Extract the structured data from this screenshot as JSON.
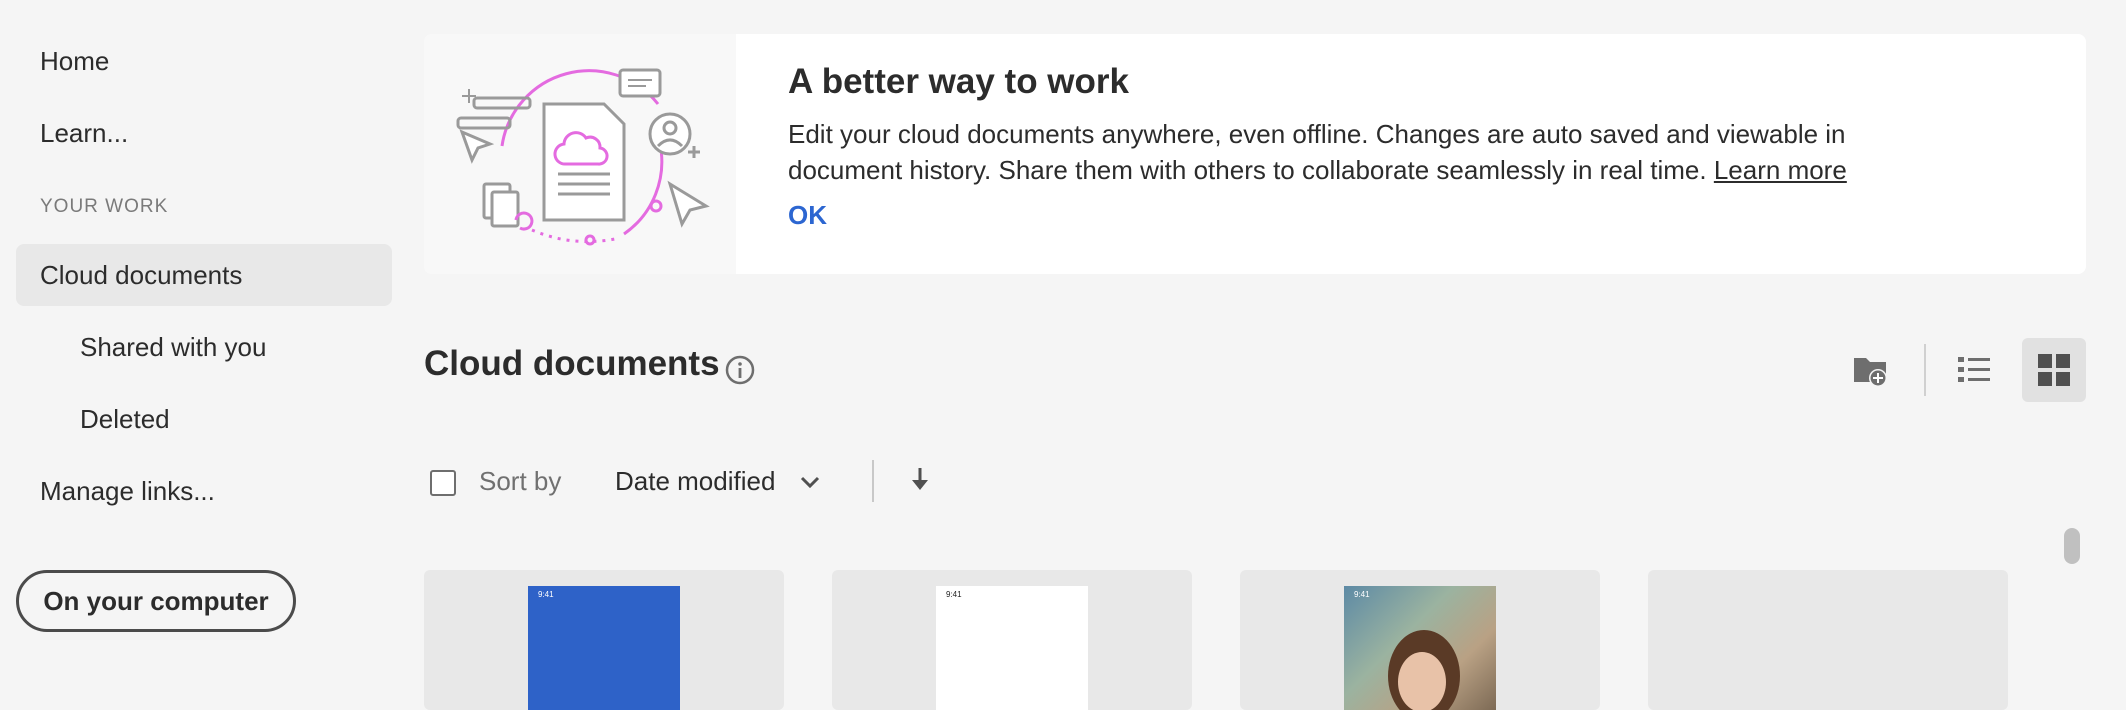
{
  "sidebar": {
    "items": [
      {
        "label": "Home"
      },
      {
        "label": "Learn..."
      },
      {
        "label": "Cloud documents"
      },
      {
        "label": "Shared with you"
      },
      {
        "label": "Deleted"
      },
      {
        "label": "Manage links..."
      }
    ],
    "section_label": "YOUR WORK",
    "computer_button": "On your computer"
  },
  "banner": {
    "title": "A better way to work",
    "body": "Edit your cloud documents anywhere, even offline. Changes are auto saved and viewable in document history. Share them with others to collaborate seamlessly in real time.",
    "learn_more": "Learn more",
    "ok": "OK"
  },
  "main": {
    "title": "Cloud documents",
    "sort_label": "Sort by",
    "sort_value": "Date modified"
  },
  "cards": [
    {
      "status_time": "9:41",
      "thumb_color": "#2e62c8"
    },
    {
      "status_time": "9:41",
      "thumb_color": "#ffffff"
    },
    {
      "status_time": "9:41",
      "thumb_color": "photo"
    },
    {
      "status_time": "",
      "thumb_color": "#e8e8e8"
    }
  ],
  "colors": {
    "accent": "#2c66d1",
    "illustration_accent": "#e46be0"
  },
  "icons": [
    "info-icon",
    "new-folder-icon",
    "list-view-icon",
    "grid-view-icon",
    "chevron-down-icon",
    "sort-direction-icon"
  ]
}
